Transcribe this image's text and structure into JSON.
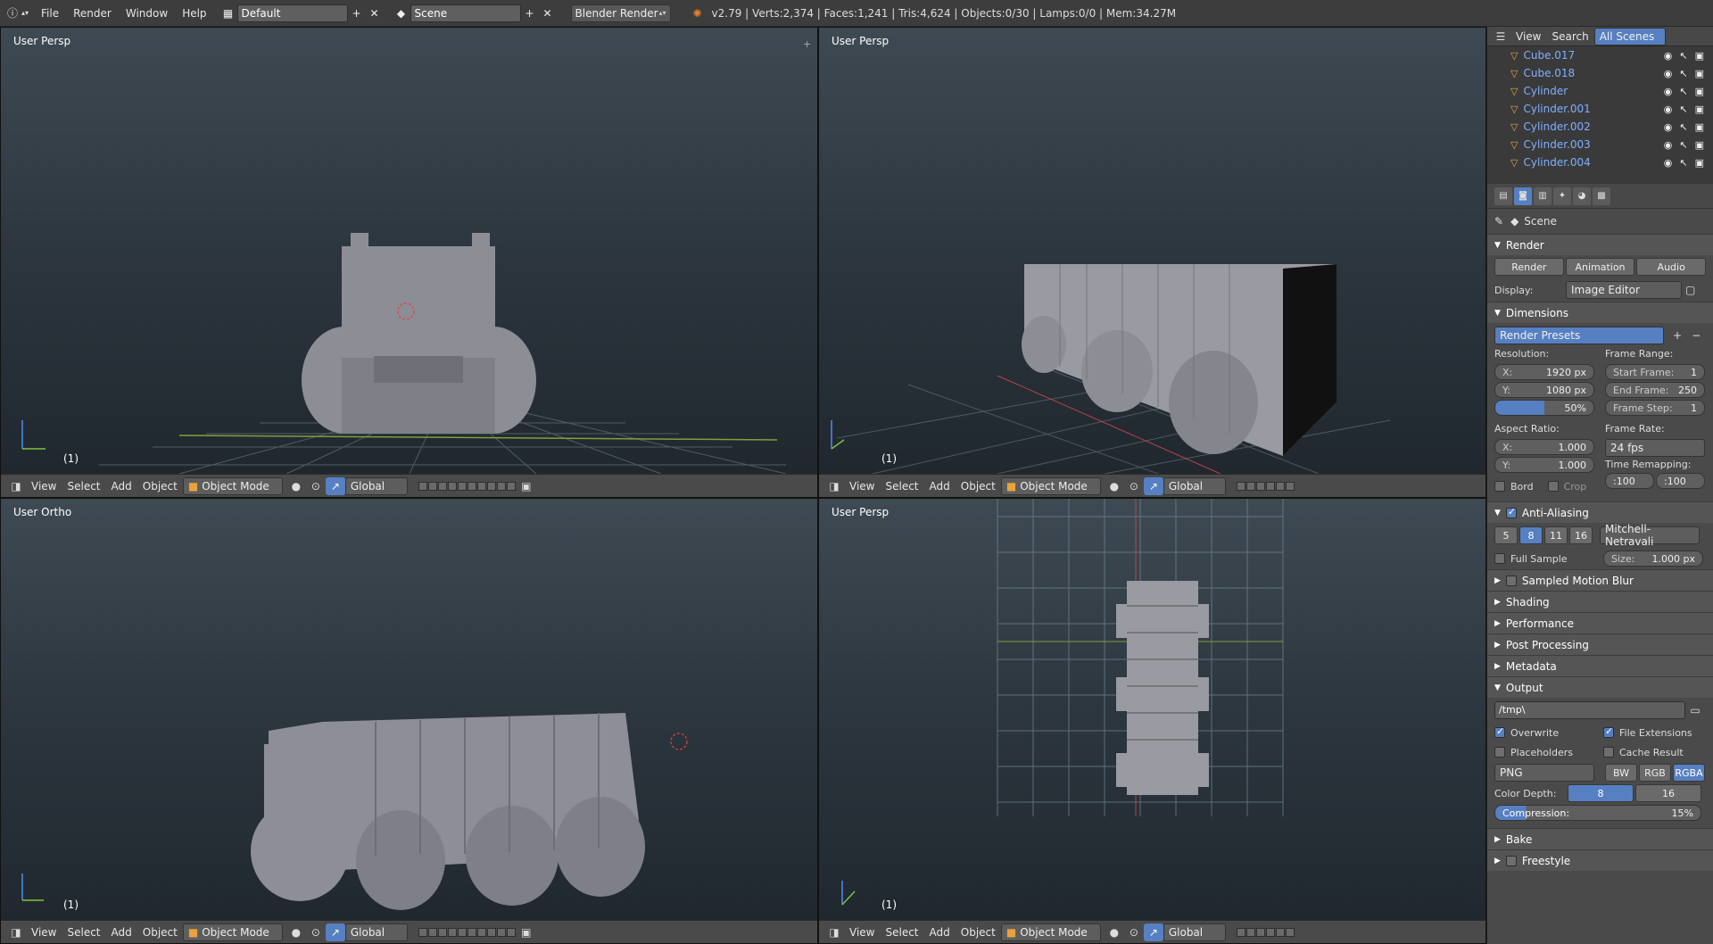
{
  "topbar": {
    "menus": [
      "File",
      "Render",
      "Window",
      "Help"
    ],
    "screen_layout": "Default",
    "scene": "Scene",
    "engine": "Blender Render",
    "stats": "v2.79 | Verts:2,374 | Faces:1,241 | Tris:4,624 | Objects:0/30 | Lamps:0/0 | Mem:34.27M"
  },
  "viewports": [
    {
      "label": "User Persp",
      "frame": "(1)"
    },
    {
      "label": "User Persp",
      "frame": "(1)"
    },
    {
      "label": "User Ortho",
      "frame": "(1)"
    },
    {
      "label": "User Persp",
      "frame": "(1)"
    }
  ],
  "viewport_header": {
    "view": "View",
    "select": "Select",
    "add": "Add",
    "object": "Object",
    "mode": "Object Mode",
    "orientation": "Global"
  },
  "outliner": {
    "view": "View",
    "search": "Search",
    "filter": "All Scenes",
    "items": [
      "Cube.017",
      "Cube.018",
      "Cylinder",
      "Cylinder.001",
      "Cylinder.002",
      "Cylinder.003",
      "Cylinder.004"
    ]
  },
  "properties": {
    "context": "Scene",
    "render": {
      "title": "Render",
      "render_btn": "Render",
      "animation_btn": "Animation",
      "audio_btn": "Audio",
      "display_label": "Display:",
      "display_value": "Image Editor"
    },
    "dimensions": {
      "title": "Dimensions",
      "presets": "Render Presets",
      "resolution_label": "Resolution:",
      "res_x_key": "X:",
      "res_x": "1920 px",
      "res_y_key": "Y:",
      "res_y": "1080 px",
      "res_pct": "50%",
      "frame_range_label": "Frame Range:",
      "start_key": "Start Frame:",
      "start": "1",
      "end_key": "End Frame:",
      "end": "250",
      "step_key": "Frame Step:",
      "step": "1",
      "aspect_label": "Aspect Ratio:",
      "asp_x_key": "X:",
      "asp_x": "1.000",
      "asp_y_key": "Y:",
      "asp_y": "1.000",
      "framerate_label": "Frame Rate:",
      "framerate": "24 fps",
      "remap_label": "Time Remapping:",
      "remap_old": ":100",
      "remap_new": ":100",
      "bord": "Bord",
      "crop": "Crop"
    },
    "antialiasing": {
      "title": "Anti-Aliasing",
      "samples": [
        "5",
        "8",
        "11",
        "16"
      ],
      "filter": "Mitchell-Netravali",
      "full_sample": "Full Sample",
      "size_key": "Size:",
      "size": "1.000 px"
    },
    "collapsed": [
      "Sampled Motion Blur",
      "Shading",
      "Performance",
      "Post Processing",
      "Metadata"
    ],
    "output": {
      "title": "Output",
      "path": "/tmp\\",
      "overwrite": "Overwrite",
      "file_ext": "File Extensions",
      "placeholders": "Placeholders",
      "cache": "Cache Result",
      "format": "PNG",
      "bw": "BW",
      "rgb": "RGB",
      "rgba": "RGBA",
      "depth_label": "Color Depth:",
      "depth8": "8",
      "depth16": "16",
      "compression_key": "Compression:",
      "compression": "15%",
      "compression_level": 0.15
    },
    "bake": "Bake",
    "freestyle": "Freestyle"
  },
  "colors": {
    "accent": "#5680c2",
    "object_name": "#7eb0ff",
    "mesh_icon": "#e8a33d"
  }
}
